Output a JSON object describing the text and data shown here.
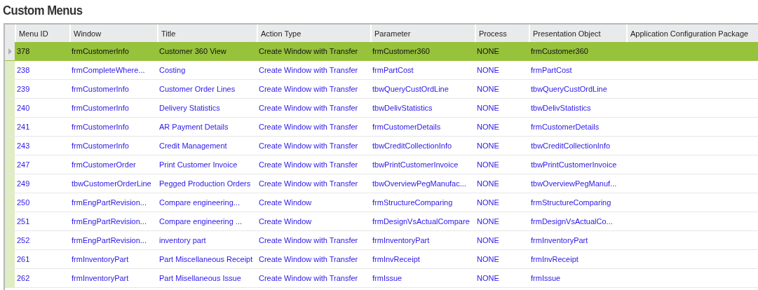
{
  "page_title": "Custom Menus",
  "table": {
    "columns": [
      "Menu ID",
      "Window",
      "Title",
      "Action Type",
      "Parameter",
      "Process",
      "Presentation Object",
      "Application Configuration Package"
    ],
    "rows": [
      {
        "selected": true,
        "cells": [
          "378",
          "frmCustomerInfo",
          "Customer 360 View",
          "Create Window with Transfer",
          "frmCustomer360",
          "NONE",
          "frmCustomer360"
        ]
      },
      {
        "selected": false,
        "cells": [
          "238",
          "frmCompleteWhere...",
          "Costing",
          "Create Window with Transfer",
          "frmPartCost",
          "NONE",
          "frmPartCost"
        ]
      },
      {
        "selected": false,
        "cells": [
          "239",
          "frmCustomerInfo",
          "Customer Order Lines",
          "Create Window with Transfer",
          "tbwQueryCustOrdLine",
          "NONE",
          "tbwQueryCustOrdLine"
        ]
      },
      {
        "selected": false,
        "cells": [
          "240",
          "frmCustomerInfo",
          "Delivery Statistics",
          "Create Window with Transfer",
          "tbwDelivStatistics",
          "NONE",
          "tbwDelivStatistics"
        ]
      },
      {
        "selected": false,
        "cells": [
          "241",
          "frmCustomerInfo",
          "AR Payment Details",
          "Create Window with Transfer",
          "frmCustomerDetails",
          "NONE",
          "frmCustomerDetails"
        ]
      },
      {
        "selected": false,
        "cells": [
          "243",
          "frmCustomerInfo",
          "Credit Management",
          "Create Window with Transfer",
          "tbwCreditCollectionInfo",
          "NONE",
          "tbwCreditCollectionInfo"
        ]
      },
      {
        "selected": false,
        "cells": [
          "247",
          "frmCustomerOrder",
          "Print Customer Invoice",
          "Create Window with Transfer",
          "tbwPrintCustomerInvoice",
          "NONE",
          "tbwPrintCustomerInvoice"
        ]
      },
      {
        "selected": false,
        "cells": [
          "249",
          "tbwCustomerOrderLine",
          "Pegged Production Orders",
          "Create Window with Transfer",
          "tbwOverviewPegManufac...",
          "NONE",
          "tbwOverviewPegManuf..."
        ]
      },
      {
        "selected": false,
        "cells": [
          "250",
          "frmEngPartRevision...",
          "Compare engineering...",
          "Create Window",
          "frmStructureComparing",
          "NONE",
          "frmStructureComparing"
        ]
      },
      {
        "selected": false,
        "cells": [
          "251",
          "frmEngPartRevision...",
          "Compare engineering ...",
          "Create Window",
          "frmDesignVsActualCompare",
          "NONE",
          "frmDesignVsActualCo..."
        ]
      },
      {
        "selected": false,
        "cells": [
          "252",
          "frmEngPartRevision...",
          "inventory part",
          "Create Window with Transfer",
          "frmInventoryPart",
          "NONE",
          "frmInventoryPart"
        ]
      },
      {
        "selected": false,
        "cells": [
          "261",
          "frmInventoryPart",
          "Part Miscellaneous Receipt",
          "Create Window with Transfer",
          "frmInvReceipt",
          "NONE",
          "frmInvReceipt"
        ]
      },
      {
        "selected": false,
        "cells": [
          "262",
          "frmInventoryPart",
          "Part Misellaneous Issue",
          "Create Window with Transfer",
          "frmIssue",
          "NONE",
          "frmIssue"
        ]
      }
    ]
  }
}
